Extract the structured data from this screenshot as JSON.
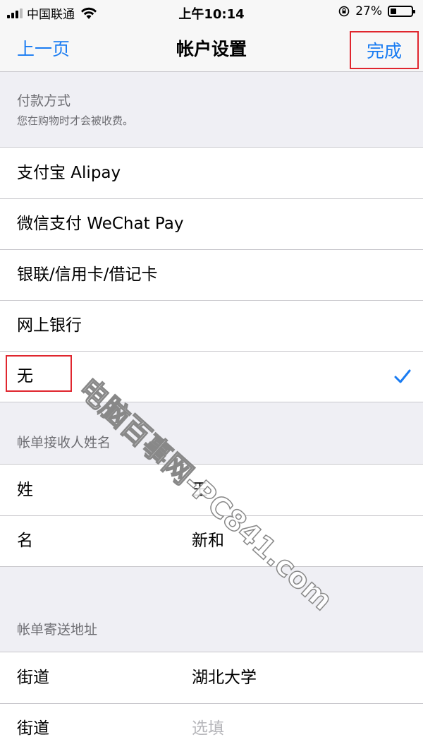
{
  "status_bar": {
    "carrier": "中国联通",
    "time": "上午10:14",
    "battery_text": "27%",
    "battery_fraction": 0.27
  },
  "nav": {
    "back_label": "上一页",
    "title": "帐户设置",
    "done_label": "完成"
  },
  "payment": {
    "header": "付款方式",
    "subheader": "您在购物时才会被收费。",
    "options": [
      {
        "label": "支付宝 Alipay"
      },
      {
        "label": "微信支付 WeChat Pay"
      },
      {
        "label": "银联/信用卡/借记卡"
      },
      {
        "label": "网上银行"
      },
      {
        "label": "无",
        "selected": true
      }
    ]
  },
  "billing_name": {
    "header": "帐单接收人姓名",
    "fields": [
      {
        "label": "姓",
        "value": "王"
      },
      {
        "label": "名",
        "value": "新和"
      }
    ]
  },
  "billing_address": {
    "header": "帐单寄送地址",
    "fields": [
      {
        "label": "街道",
        "value": "湖北大学"
      },
      {
        "label": "街道",
        "placeholder": "选填"
      }
    ]
  },
  "watermark": "电脑百事网-PC841.com",
  "colors": {
    "accent": "#1a7cf2",
    "highlight": "#e0262e",
    "group_bg": "#efeff4"
  }
}
